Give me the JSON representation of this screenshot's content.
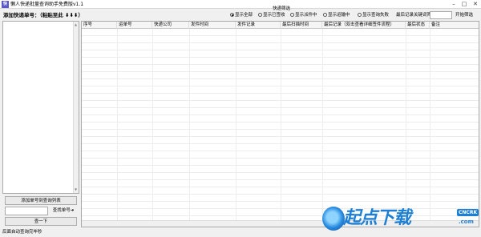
{
  "window": {
    "title": "懒人快递批量查询助手免费版v1.1",
    "icon_text": "快",
    "minimize": "–",
    "maximize": "□",
    "close": "✕"
  },
  "left_panel": {
    "label": "添加快递单号：（粘贴至此 ⬇⬇⬇）",
    "add_button": "添加单号到查询列表",
    "search_button": "查找单号➔",
    "refresh_button": "查一下"
  },
  "status_bar": {
    "text": "后面自动查询完毕秒"
  },
  "filter": {
    "title": "快递筛选",
    "options": [
      {
        "label": "显示全部",
        "selected": true
      },
      {
        "label": "显示已签收",
        "selected": false
      },
      {
        "label": "显示派件中",
        "selected": false
      },
      {
        "label": "显示运输中",
        "selected": false
      },
      {
        "label": "显示查询失败",
        "selected": false
      }
    ],
    "keyword_label": "最后记录关键词筛选",
    "keyword_value": "",
    "filter_button": "开始筛选"
  },
  "table": {
    "columns": [
      "序号",
      "运单号",
      "快递公司",
      "发件时间",
      "发件记录",
      "最后扫描时间",
      "最后记录（双击查看详细签件流程）",
      "最后状态",
      "备注"
    ]
  },
  "watermark": {
    "text": "起点下载",
    "badge": "CNCRK",
    "domain": ".com"
  }
}
